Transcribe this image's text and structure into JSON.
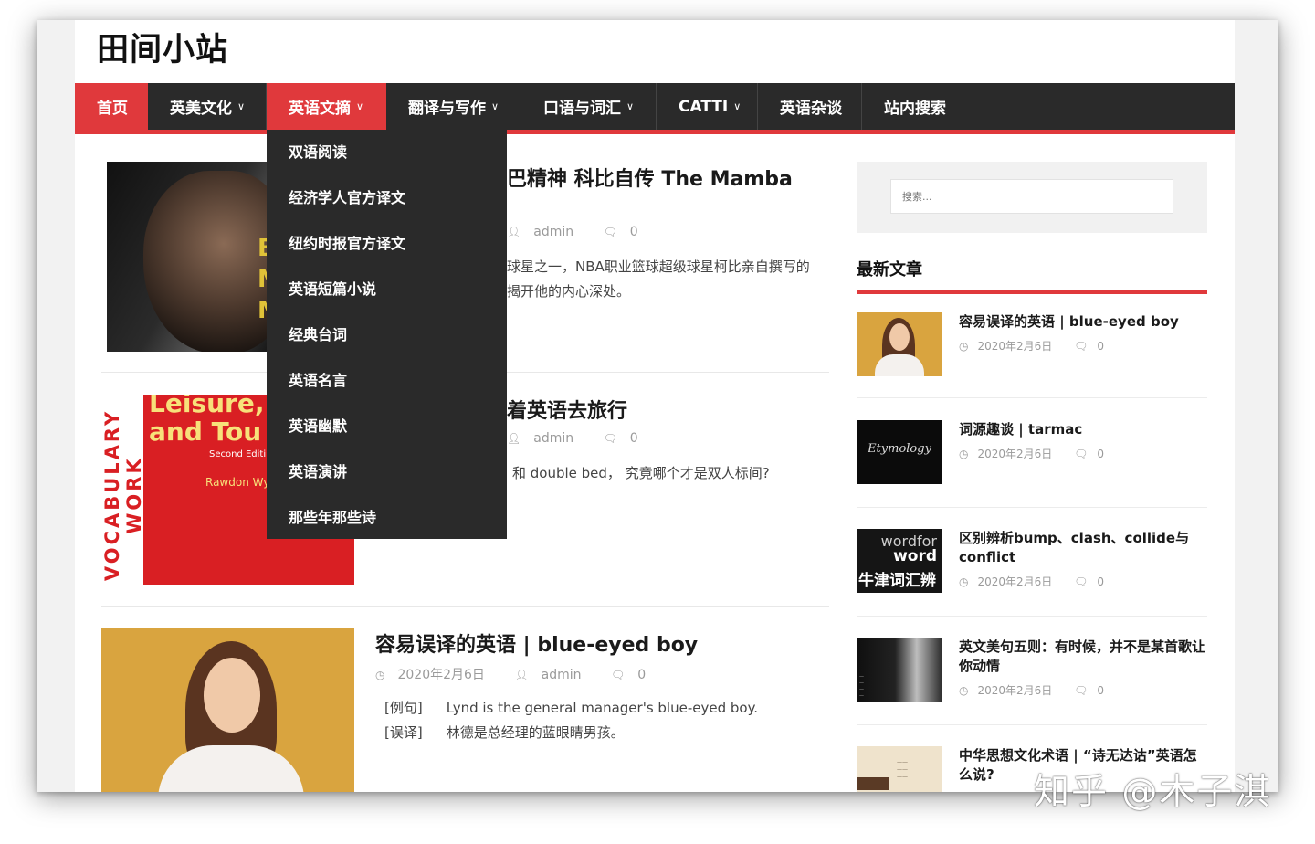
{
  "site": {
    "title": "田间小站"
  },
  "nav": {
    "items": [
      {
        "label": "首页"
      },
      {
        "label": "英美文化"
      },
      {
        "label": "英语文摘"
      },
      {
        "label": "翻译与写作"
      },
      {
        "label": "口语与词汇"
      },
      {
        "label": "CATTI"
      },
      {
        "label": "英语杂谈"
      },
      {
        "label": "站内搜索"
      }
    ],
    "caret": "⌄",
    "active_color": "#e0393c",
    "bar_color": "#2a2a2a"
  },
  "dropdown": {
    "items": [
      {
        "label": "双语阅读"
      },
      {
        "label": "经济学人官方译文"
      },
      {
        "label": "纽约时报官方译文"
      },
      {
        "label": "英语短篇小说"
      },
      {
        "label": "经典台词"
      },
      {
        "label": "英语名言"
      },
      {
        "label": "英语幽默"
      },
      {
        "label": "英语演讲"
      },
      {
        "label": "那些年那些诗"
      }
    ]
  },
  "posts": [
    {
      "title": "巴精神 科比自传 The Mamba",
      "author": "admin",
      "comments": "0",
      "excerpt_1": "球星之一，NBA职业篮球超级球星柯比亲自撰写的",
      "excerpt_2": "揭开他的内心深处。",
      "thumb_text_1": "B",
      "thumb_text_2": "M",
      "thumb_text_3": "ME"
    },
    {
      "title": "着英语去旅行",
      "author": "admin",
      "comments": "0",
      "excerpt_1": "和 double bed， 究竟哪个才是双人标间?",
      "book_side": "VOCABULARY WORK",
      "book_title_1": "Leisure, T",
      "book_title_2": "and Tou",
      "book_sub": "Second Editi",
      "book_author": "Rawdon Wy"
    },
    {
      "title": "容易误译的英语 | blue-eyed boy",
      "date": "2020年2月6日",
      "author": "admin",
      "comments": "0",
      "example_label": "[例句]",
      "example_text": "Lynd is the general manager's blue-eyed boy.",
      "mistrans_label": "[误译]",
      "mistrans_text": "林德是总经理的蓝眼睛男孩。"
    }
  ],
  "sidebar": {
    "search_placeholder": "搜索...",
    "recent_title": "最新文章",
    "recent": [
      {
        "title": "容易误译的英语 | blue-eyed boy",
        "date": "2020年2月6日",
        "comments": "0"
      },
      {
        "title": "词源趣谈 | tarmac",
        "date": "2020年2月6日",
        "comments": "0",
        "thumb_text": "Etymology"
      },
      {
        "title": "区别辨析bump、clash、collide与conflict",
        "date": "2020年2月6日",
        "comments": "0",
        "thumb_text_1": "wordfor",
        "thumb_text_2": "word",
        "thumb_text_3": "牛津词汇辨析"
      },
      {
        "title": "英文美句五则：有时候，并不是某首歌让你动情",
        "date": "2020年2月6日",
        "comments": "0"
      },
      {
        "title": "中华思想文化术语 | “诗无达诂”英语怎么说?"
      }
    ]
  },
  "watermark": "知乎 @木子淇",
  "icons": {
    "clock": "clock-icon",
    "user": "user-icon",
    "comment": "comment-icon",
    "chevron": "chevron-down-icon"
  }
}
